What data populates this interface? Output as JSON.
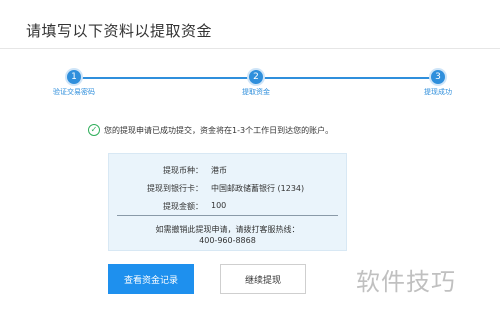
{
  "header": {
    "title": "请填写以下资料以提取资金"
  },
  "stepper": {
    "accent_color": "#2f8fdc",
    "steps": [
      {
        "number": "1",
        "label": "验证交易密码"
      },
      {
        "number": "2",
        "label": "提取资金"
      },
      {
        "number": "3",
        "label": "提现成功"
      }
    ]
  },
  "success": {
    "icon": "check-circle-icon",
    "message": "您的提现申请已成功提交，资金将在1-3个工作日到达您的账户。"
  },
  "details": {
    "rows": [
      {
        "label": "提现币种：",
        "value": "港币"
      },
      {
        "label": "提现到银行卡：",
        "value": "中国邮政储蓄银行 (1234)"
      },
      {
        "label": "提现金额：",
        "value": "100"
      }
    ],
    "note_line1": "如需撤销此提现申请，请拨打客服热线：",
    "note_line2": "400-960-8868"
  },
  "actions": {
    "view_records": "查看资金记录",
    "continue_withdraw": "继续提现"
  },
  "watermark": {
    "text": "软件技巧"
  }
}
